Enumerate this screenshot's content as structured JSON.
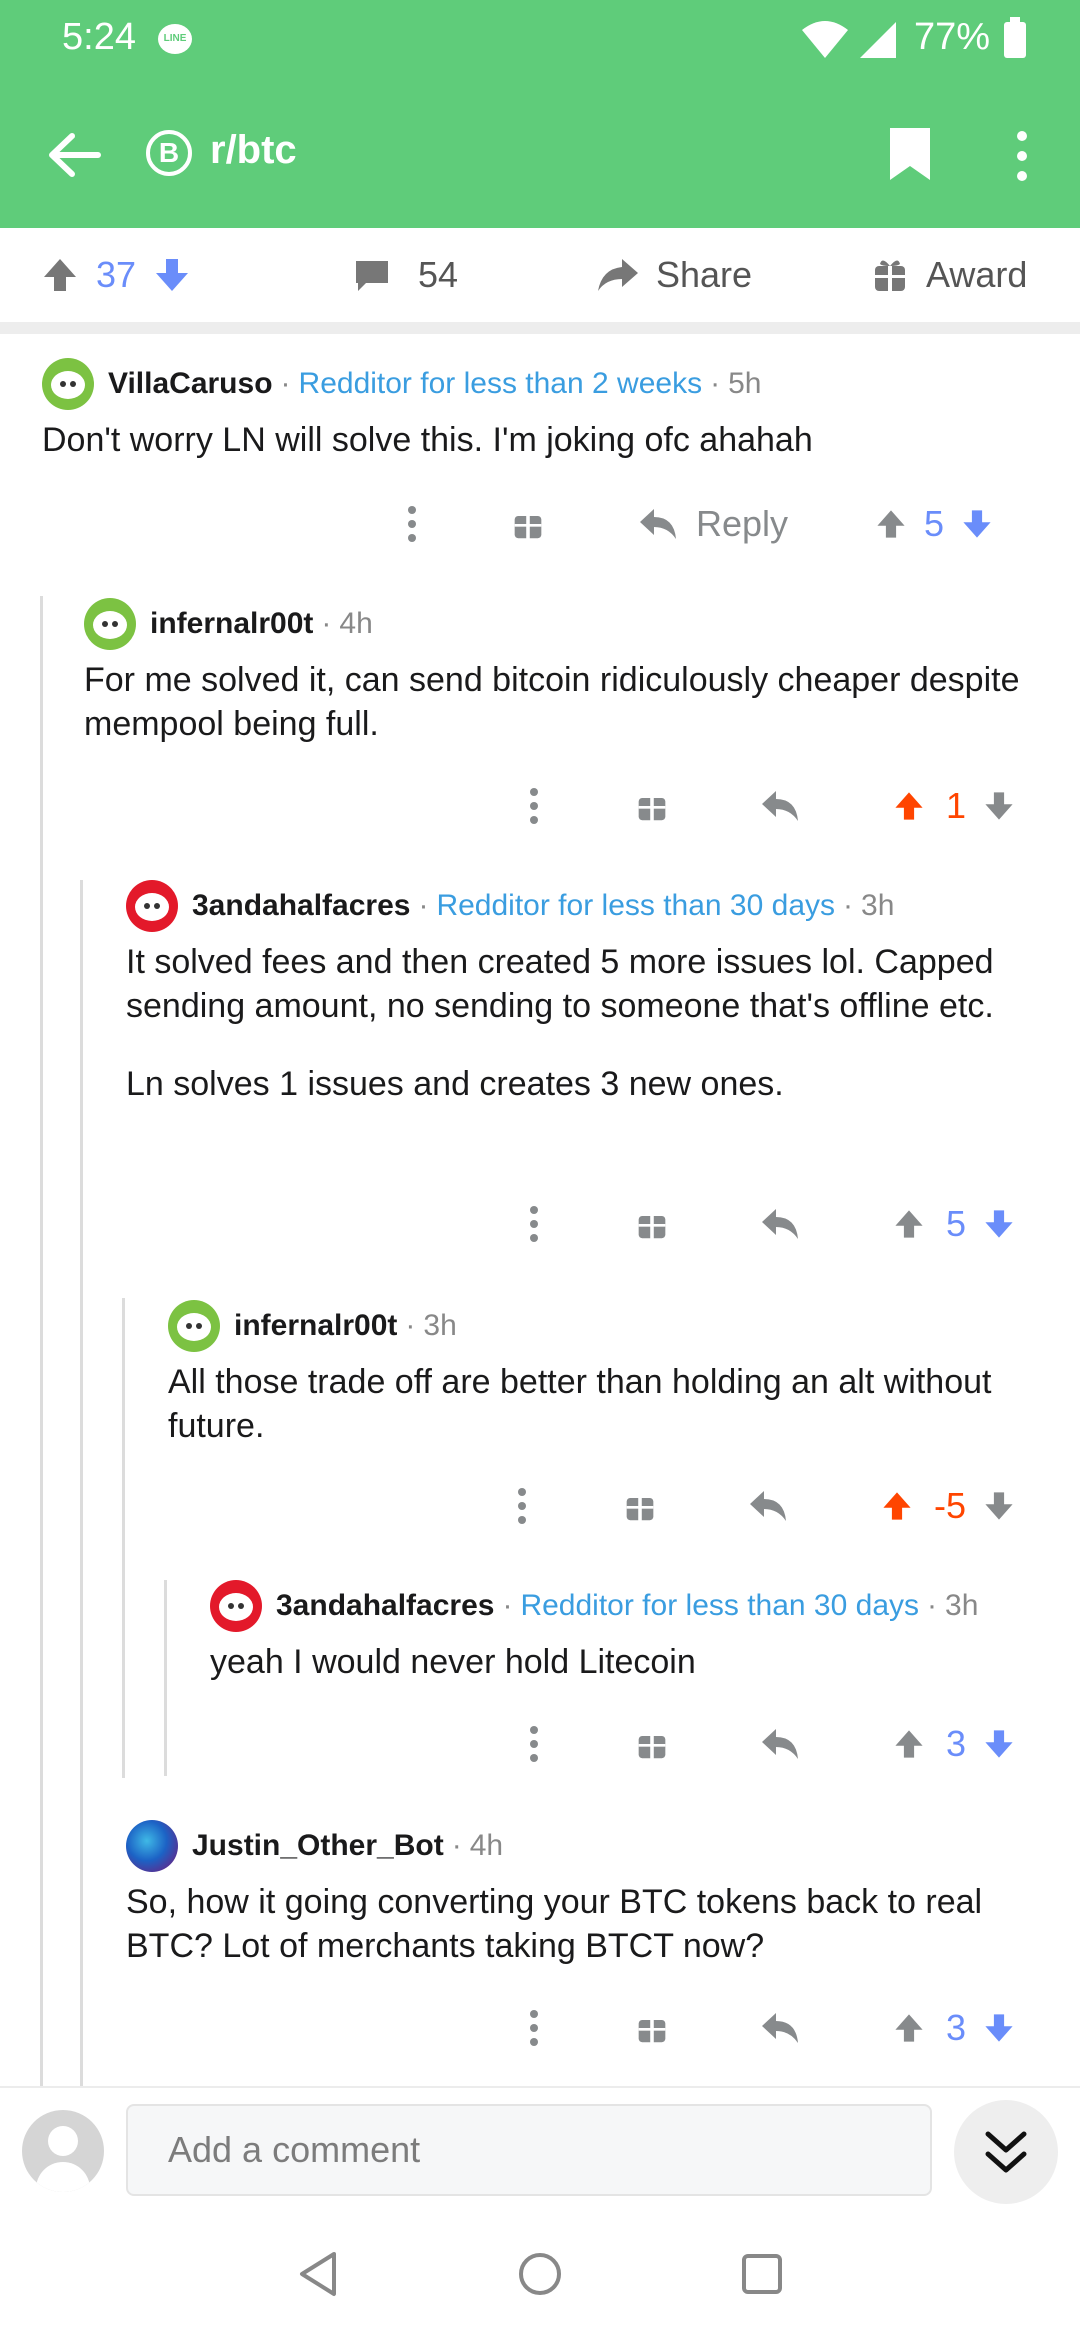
{
  "status": {
    "time": "5:24",
    "notification_app": "LINE",
    "battery": "77%"
  },
  "toolbar": {
    "subreddit": "r/btc",
    "coin_symbol": "B"
  },
  "post_actions": {
    "score": "37",
    "comments": "54",
    "share_label": "Share",
    "award_label": "Award"
  },
  "comments": [
    {
      "username": "VillaCaruso",
      "flair": "Redditor for less than 2 weeks",
      "age": "5h",
      "text": "Don't worry LN will solve this. I'm joking ofc ahahah",
      "reply_label": "Reply",
      "score": "5",
      "vote": "none"
    },
    {
      "username": "infernalr00t",
      "flair": "",
      "age": "4h",
      "text": "For me solved it, can send bitcoin ridiculously cheaper despite mempool being full.",
      "score": "1",
      "vote": "up"
    },
    {
      "username": "3andahalfacres",
      "flair": "Redditor for less than 30 days",
      "age": "3h",
      "text": "It solved fees and then created 5 more issues lol. Capped sending amount, no sending to someone that's offline etc.",
      "text2": "Ln solves 1 issues and creates 3 new ones.",
      "score": "5",
      "vote": "none"
    },
    {
      "username": "infernalr00t",
      "flair": "",
      "age": "3h",
      "text": "All those trade off are better than holding an alt without future.",
      "score": "-5",
      "vote": "up"
    },
    {
      "username": "3andahalfacres",
      "flair": "Redditor for less than 30 days",
      "age": "3h",
      "text": "yeah I would never hold Litecoin",
      "score": "3",
      "vote": "none"
    },
    {
      "username": "Justin_Other_Bot",
      "flair": "",
      "age": "4h",
      "text": "So, how it going converting your BTC tokens back to real BTC? Lot of merchants taking BTCT now?",
      "score": "3",
      "vote": "none"
    }
  ],
  "composer": {
    "placeholder": "Add a comment"
  },
  "colors": {
    "header_green": "#5fcc7a",
    "upvote_orange": "#ff4500",
    "score_blue": "#6a8dfa",
    "flair_blue": "#3a9de0"
  }
}
